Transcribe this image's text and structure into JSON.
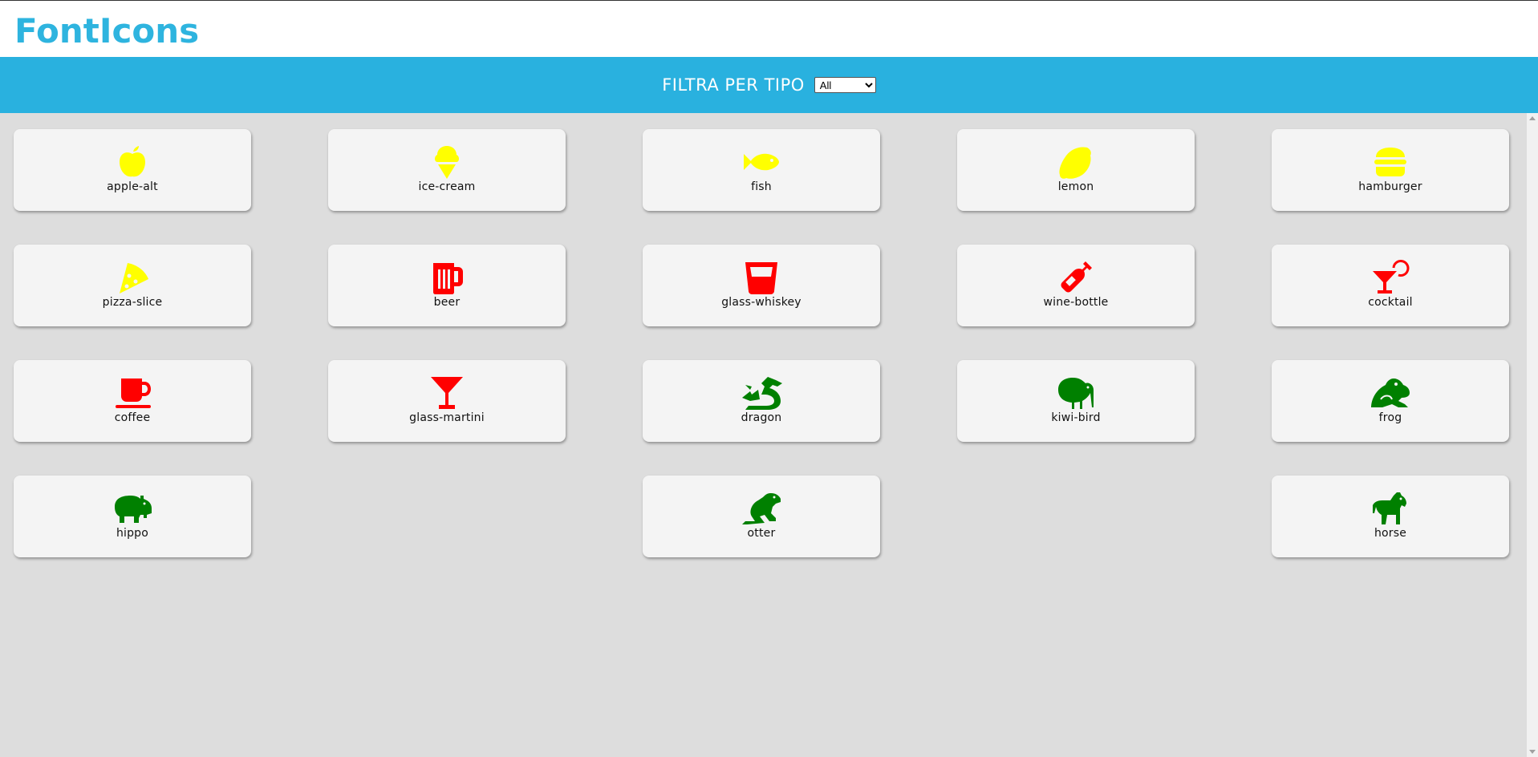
{
  "app": {
    "logo": "FontIcons"
  },
  "filter": {
    "label": "FILTRA PER TIPO",
    "selected": "All"
  },
  "colors": {
    "food": "#ffff00",
    "drink": "#ff0000",
    "animal": "#008000",
    "accent": "#29b1df"
  },
  "icons": [
    {
      "label": "apple-alt",
      "type": "food"
    },
    {
      "label": "ice-cream",
      "type": "food"
    },
    {
      "label": "fish",
      "type": "food"
    },
    {
      "label": "lemon",
      "type": "food"
    },
    {
      "label": "hamburger",
      "type": "food"
    },
    {
      "label": "pizza-slice",
      "type": "food"
    },
    {
      "label": "beer",
      "type": "drink"
    },
    {
      "label": "glass-whiskey",
      "type": "drink"
    },
    {
      "label": "wine-bottle",
      "type": "drink"
    },
    {
      "label": "cocktail",
      "type": "drink"
    },
    {
      "label": "coffee",
      "type": "drink"
    },
    {
      "label": "glass-martini",
      "type": "drink"
    },
    {
      "label": "dragon",
      "type": "animal"
    },
    {
      "label": "kiwi-bird",
      "type": "animal"
    },
    {
      "label": "frog",
      "type": "animal"
    },
    {
      "label": "hippo",
      "type": "animal"
    },
    {
      "label": "otter",
      "type": "animal"
    },
    {
      "label": "horse",
      "type": "animal"
    }
  ]
}
